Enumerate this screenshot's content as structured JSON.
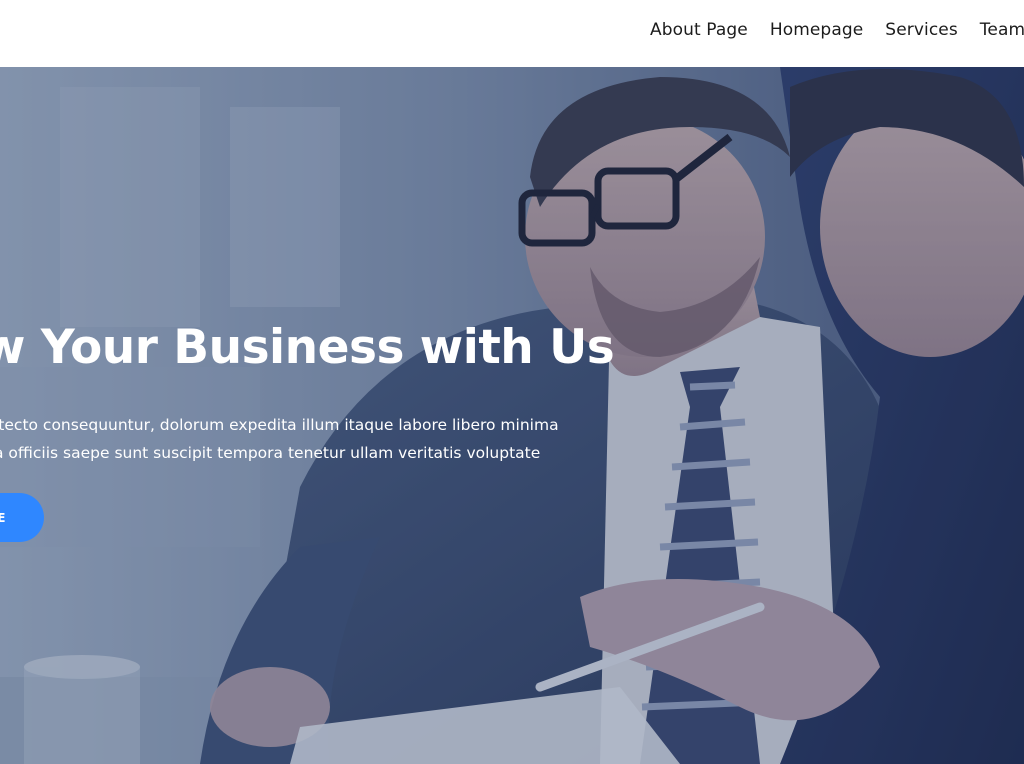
{
  "nav": {
    "items": [
      {
        "label": "About Page"
      },
      {
        "label": "Homepage"
      },
      {
        "label": "Services"
      },
      {
        "label": "Team I"
      }
    ]
  },
  "hero": {
    "title": "w Your Business with Us",
    "text_line_1": "itecto consequuntur, dolorum expedita illum itaque labore libero minima",
    "text_line_2": "a officiis saepe sunt suscipit tempora tenetur ullam veritatis voluptate",
    "button_label": "E",
    "image_subject": "two-businessmen-reviewing-documents-photo"
  },
  "colors": {
    "accent": "#2f87ff",
    "header_bg": "#ffffff",
    "nav_text": "#1c1c1c",
    "hero_text": "#ffffff"
  }
}
